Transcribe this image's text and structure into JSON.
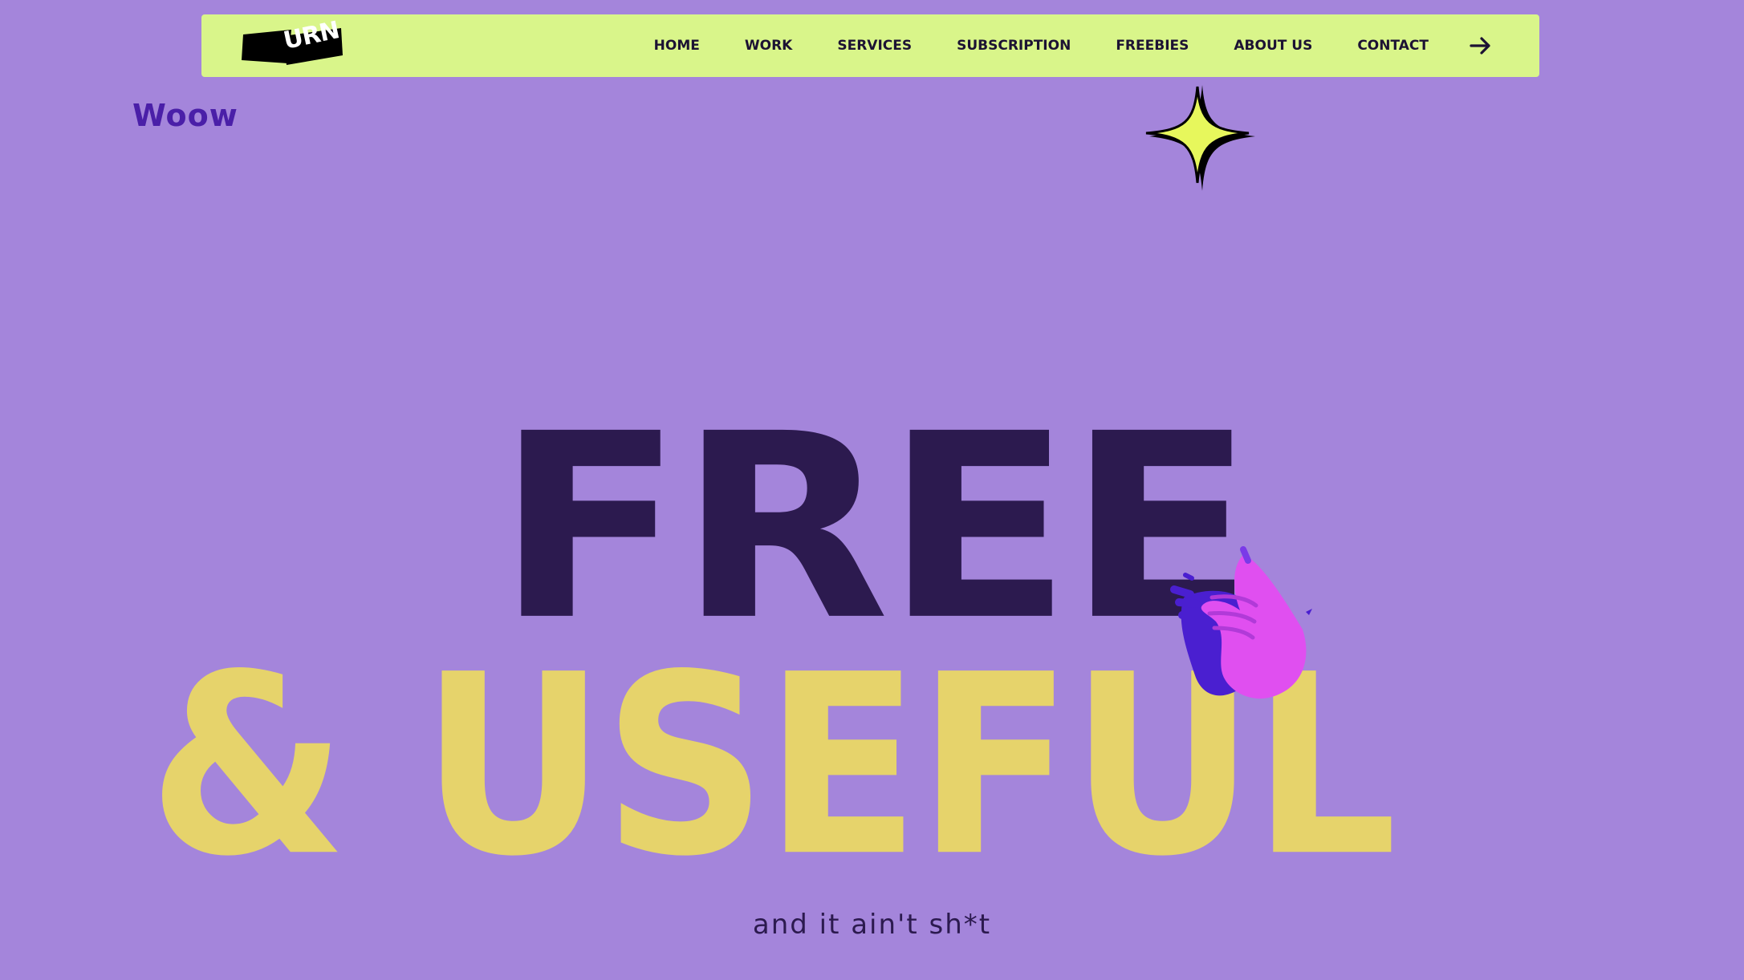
{
  "nav": {
    "logo_text": "URN",
    "items": [
      {
        "label": "HOME"
      },
      {
        "label": "WORK"
      },
      {
        "label": "SERVICES"
      },
      {
        "label": "SUBSCRIPTION"
      },
      {
        "label": "FREEBIES"
      },
      {
        "label": "ABOUT US"
      },
      {
        "label": "CONTACT"
      }
    ],
    "arrow_icon": "arrow-right-icon"
  },
  "hero": {
    "corner_text": "Woow",
    "headline_line1": "FREE",
    "headline_line2": "& USEFUL",
    "tagline": "and it ain't sh*t",
    "sparkle_icon": "sparkle-icon",
    "hand_icon": "waving-hand-icon"
  },
  "colors": {
    "background": "#a485db",
    "navbar": "#d9f58a",
    "headline_dark": "#2c1a4f",
    "headline_yellow": "#e6d36b",
    "accent_purple": "#4a1fa8",
    "hand_pink": "#e04ff0"
  }
}
